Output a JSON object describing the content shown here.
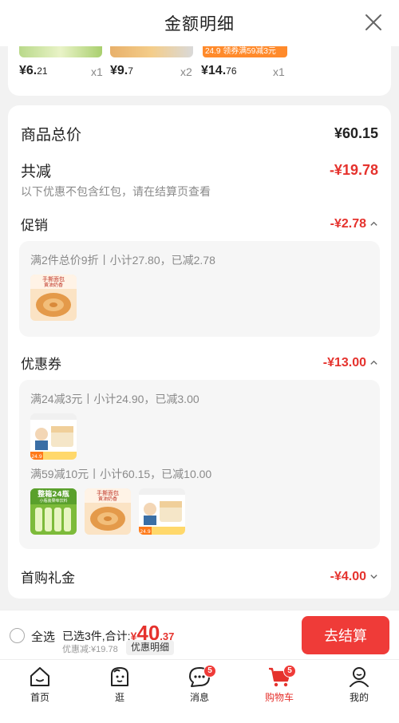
{
  "header": {
    "title": "金额明细"
  },
  "top_products": [
    {
      "price_main": "¥6.",
      "price_sub": "21",
      "qty": "x1"
    },
    {
      "price_main": "¥9.",
      "price_sub": "7",
      "qty": "x2"
    },
    {
      "price_main": "¥14.",
      "price_sub": "76",
      "qty": "x1"
    }
  ],
  "top_coupon_tag": "24.9 领券满59减3元",
  "summary": {
    "total_label": "商品总价",
    "total_value": "¥60.15",
    "reduce_label": "共减",
    "reduce_value": "-¥19.78",
    "note": "以下优惠不包含红包，请在结算页查看"
  },
  "promotion": {
    "label": "促销",
    "value": "-¥2.78",
    "rule": "满2件总价9折丨小计27.80，已减2.78"
  },
  "coupon": {
    "label": "优惠券",
    "value": "-¥13.00",
    "rule1": "满24减3元丨小计24.90，已减3.00",
    "rule2": "满59减10元丨小计60.15，已减10.00"
  },
  "first_gift": {
    "label": "首购礼金",
    "value": "-¥4.00"
  },
  "bottom": {
    "select_all": "全选",
    "summary_prefix": "已选3件,合计:",
    "currency": "¥",
    "total_int": "40",
    "total_dec": ".37",
    "discount": "优惠减:¥19.78",
    "detail_button": "优惠明细",
    "checkout_button": "去结算"
  },
  "thumb_texts": {
    "bread_title": "手撕面包",
    "bread_sub": "黄油奶香",
    "drink_title": "整箱24瓶",
    "drink_sub": "小瓶装果味饮料",
    "price_tag": "24.9"
  },
  "tabs": [
    {
      "label": "首页",
      "icon": "home-icon"
    },
    {
      "label": "逛",
      "icon": "face-icon"
    },
    {
      "label": "消息",
      "icon": "message-icon",
      "badge": "5"
    },
    {
      "label": "购物车",
      "icon": "cart-icon",
      "badge": "5",
      "active": true
    },
    {
      "label": "我的",
      "icon": "user-icon"
    }
  ],
  "colors": {
    "accent": "#e5322d",
    "checkout": "#ef3b38",
    "coupon_tag": "#ff8a2b"
  }
}
